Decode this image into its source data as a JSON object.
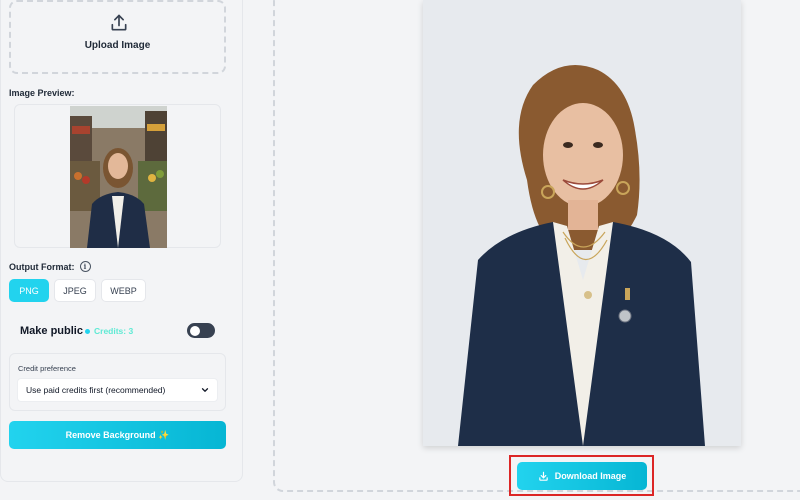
{
  "upload": {
    "label": "Upload Image",
    "icon": "upload-icon"
  },
  "preview": {
    "label": "Image Preview:"
  },
  "output_format": {
    "label": "Output Format:",
    "options": [
      "PNG",
      "JPEG",
      "WEBP"
    ],
    "selected": "PNG"
  },
  "public": {
    "label": "Make public",
    "credits": "Credits: 3",
    "toggle_on": false
  },
  "credit_preference": {
    "label": "Credit preference",
    "selected": "Use paid credits first (recommended)"
  },
  "actions": {
    "remove_label": "Remove Background ✨",
    "download_label": "Download Image"
  },
  "colors": {
    "accent": "#22d3ee",
    "accent_dark": "#06b6d4",
    "highlight": "#dc2626",
    "credits_text": "#5eead4"
  }
}
